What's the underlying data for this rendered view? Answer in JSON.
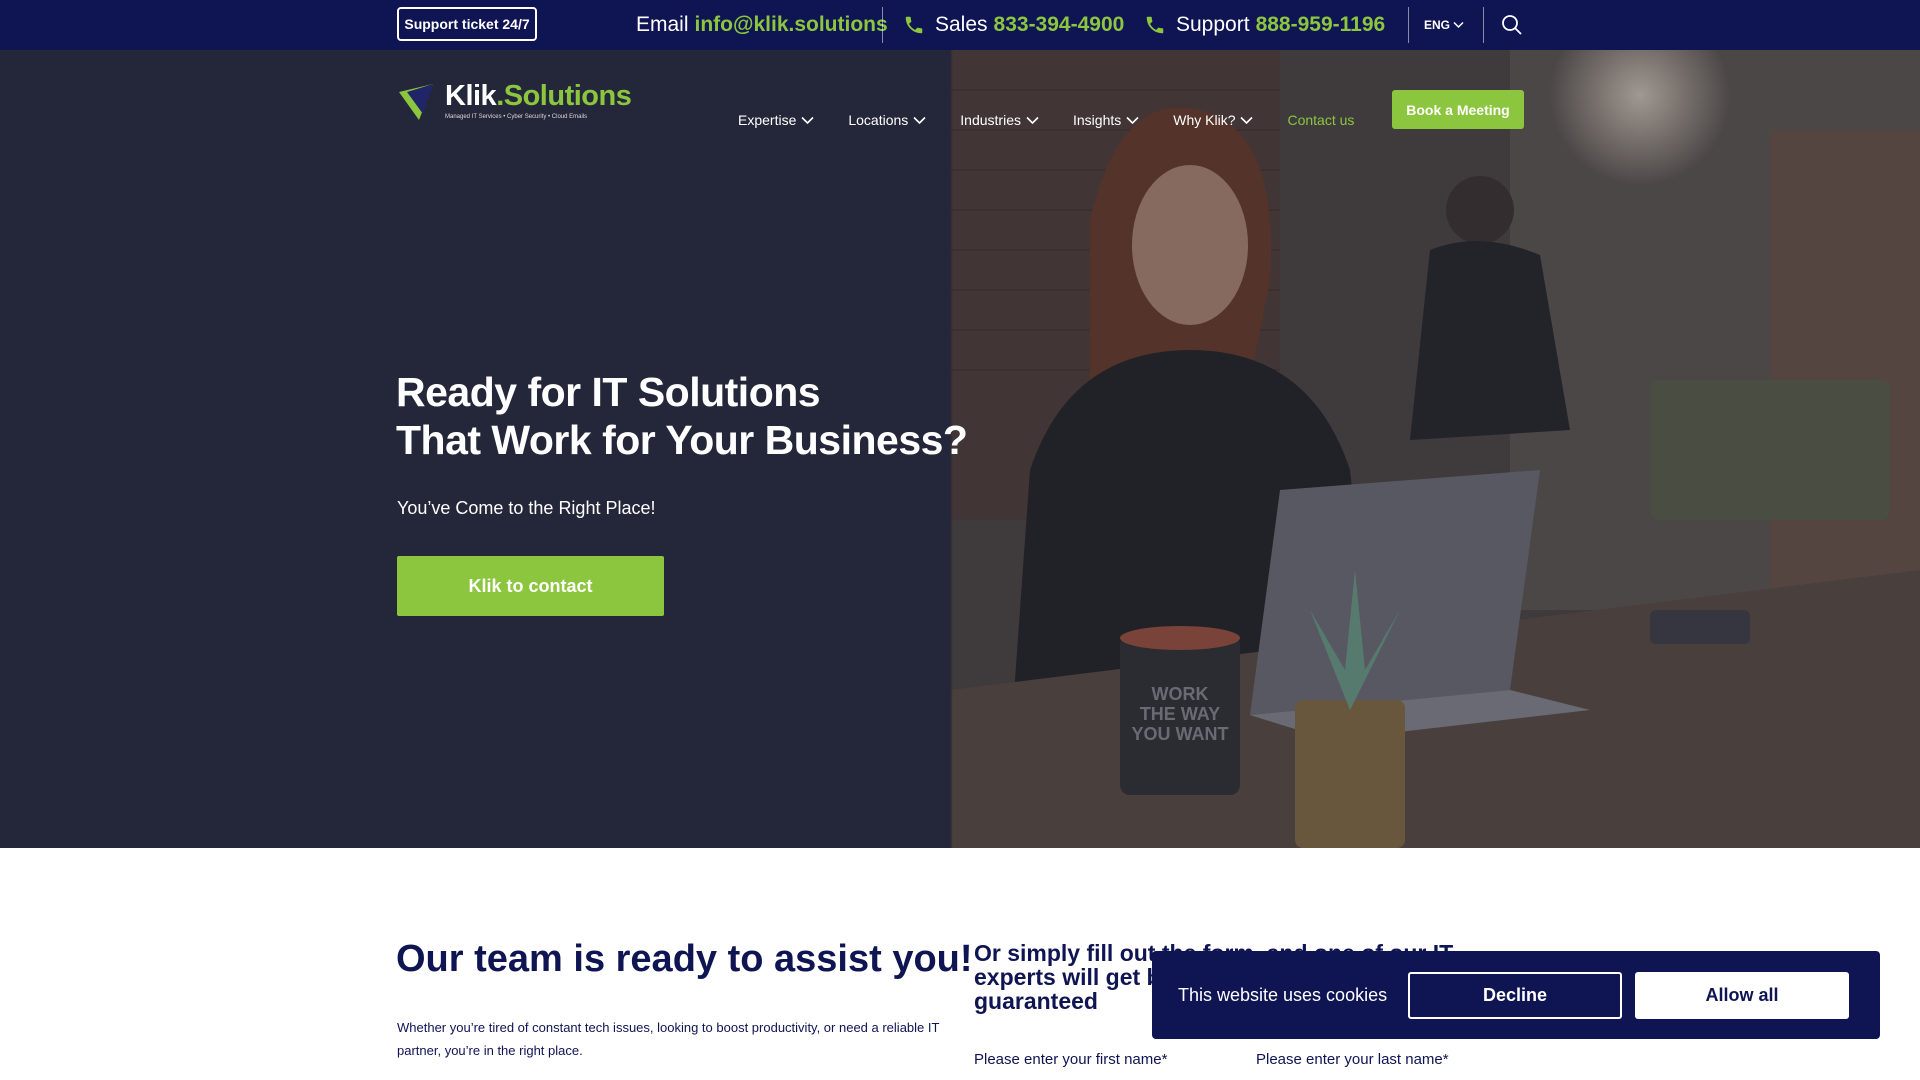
{
  "topbar": {
    "support_ticket": "Support ticket 24/7",
    "email_label": "Email",
    "email_value": "info@klik.solutions",
    "sales_label": "Sales",
    "sales_value": "833-394-4900",
    "support_label": "Support",
    "support_value": "888-959-1196",
    "language": "ENG",
    "icons": [
      "phone-icon",
      "chevron-down-icon",
      "search-icon"
    ]
  },
  "header": {
    "logo_name_main": "Klik",
    "logo_name_accent": ".Solutions",
    "logo_tagline": "Managed IT Services • Cyber Security • Cloud Emails",
    "nav": [
      "Expertise",
      "Locations",
      "Industries",
      "Insights",
      "Why Klik?"
    ],
    "contact": "Contact us",
    "book": "Book a Meeting"
  },
  "hero": {
    "title_line1": "Ready for IT Solutions",
    "title_line2": "That Work for Your Business?",
    "subtitle": "You’ve Come to the Right Place!",
    "cta": "Klik to contact",
    "mug_text": "WORK THE WAY YOU WANT"
  },
  "assist": {
    "title": "Our team is ready to assist you!",
    "text": "Whether you’re tired of constant tech issues, looking to boost productivity,  or need a reliable IT partner, you’re in the right place."
  },
  "form": {
    "intro": "Or simply fill out the form, and one of our IT experts will get back to you within 24 hours – guaranteed",
    "first_name_label": "Please enter your first name*",
    "last_name_label": "Please enter your last name*"
  },
  "cookie": {
    "text": "This website uses cookies",
    "decline": "Decline",
    "allow": "Allow all"
  },
  "colors": {
    "navy": "#0f1453",
    "green": "#8cc63f",
    "hero_dark": "#242739"
  }
}
